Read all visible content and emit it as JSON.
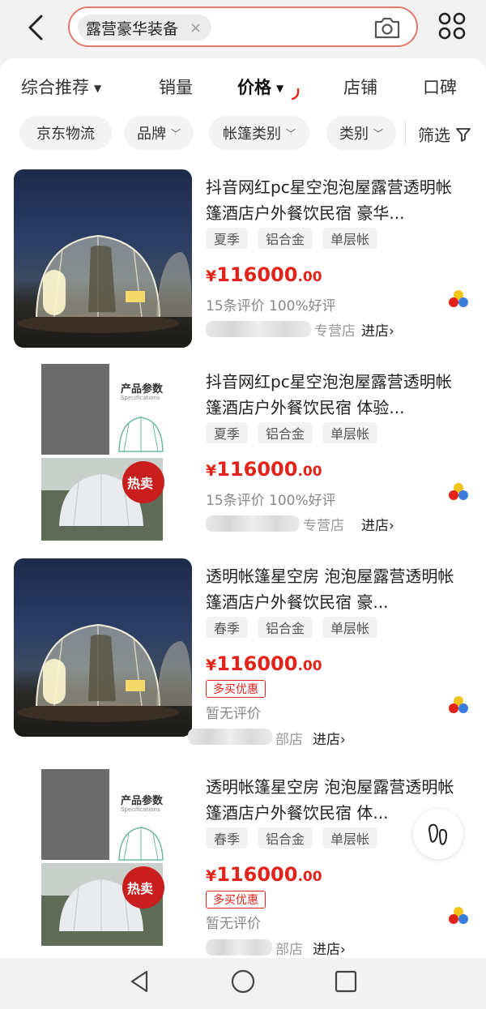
{
  "search": {
    "query": "露营豪华装备",
    "clear_symbol": "×"
  },
  "sort_tabs": [
    {
      "label": "综合推荐",
      "has_caret": true,
      "active": false
    },
    {
      "label": "销量",
      "active": false
    },
    {
      "label": "价格",
      "has_caret": true,
      "active": true
    },
    {
      "label": "店铺",
      "active": false
    },
    {
      "label": "口碑",
      "active": false
    }
  ],
  "filters": [
    {
      "label": "京东物流",
      "has_chevron": false
    },
    {
      "label": "品牌",
      "has_chevron": true
    },
    {
      "label": "帐篷类别",
      "has_chevron": true
    },
    {
      "label": "类别",
      "has_chevron": true
    }
  ],
  "filter_screen_label": "筛选",
  "products": [
    {
      "title": "抖音网红pc星空泡泡屋露营透明帐篷酒店户外餐饮民宿 豪华...",
      "tags": [
        "夏季",
        "铝合金",
        "单层帐"
      ],
      "price_symbol": "¥",
      "price_main": "116000",
      "price_dec": ".00",
      "review_text": "15条评价 100%好评",
      "shop_visible_text": "专营店",
      "enter_shop": "进店›",
      "image": "night-dome"
    },
    {
      "title": "抖音网红pc星空泡泡屋露营透明帐篷酒店户外餐饮民宿 体验...",
      "tags": [
        "夏季",
        "铝合金",
        "单层帐"
      ],
      "price_symbol": "¥",
      "price_main": "116000",
      "price_dec": ".00",
      "review_text": "15条评价 100%好评",
      "shop_visible_text": "专营店",
      "enter_shop": "进店›",
      "image": "spec-sheet",
      "image_text": {
        "spec_title": "产品参数",
        "spec_sub": "Specifications",
        "badge": "热卖"
      }
    },
    {
      "title": "透明帐篷星空房 泡泡屋露营透明帐篷酒店户外餐饮民宿 豪...",
      "tags": [
        "春季",
        "铝合金",
        "单层帐"
      ],
      "price_symbol": "¥",
      "price_main": "116000",
      "price_dec": ".00",
      "promo": "多买优惠",
      "review_text": "暂无评价",
      "shop_visible_text": "部店",
      "enter_shop": "进店›",
      "image": "night-dome"
    },
    {
      "title": "透明帐篷星空房 泡泡屋露营透明帐篷酒店户外餐饮民宿 体...",
      "tags": [
        "春季",
        "铝合金",
        "单层帐"
      ],
      "price_symbol": "¥",
      "price_main": "116000",
      "price_dec": ".00",
      "promo": "多买优惠",
      "review_text": "暂无评价",
      "shop_visible_text": "部店",
      "enter_shop": "进店›",
      "image": "spec-sheet",
      "image_text": {
        "spec_title": "产品参数",
        "spec_sub": "Specifications",
        "badge": "热卖"
      }
    }
  ],
  "colors": {
    "price_red": "#e2231a",
    "search_border": "#e2796c"
  },
  "icons": [
    "back-arrow-icon",
    "camera-icon",
    "grid-menu-icon",
    "filter-funnel-icon",
    "colorful-dots-icon",
    "footprint-icon",
    "nav-back-icon",
    "nav-home-icon",
    "nav-recents-icon"
  ]
}
